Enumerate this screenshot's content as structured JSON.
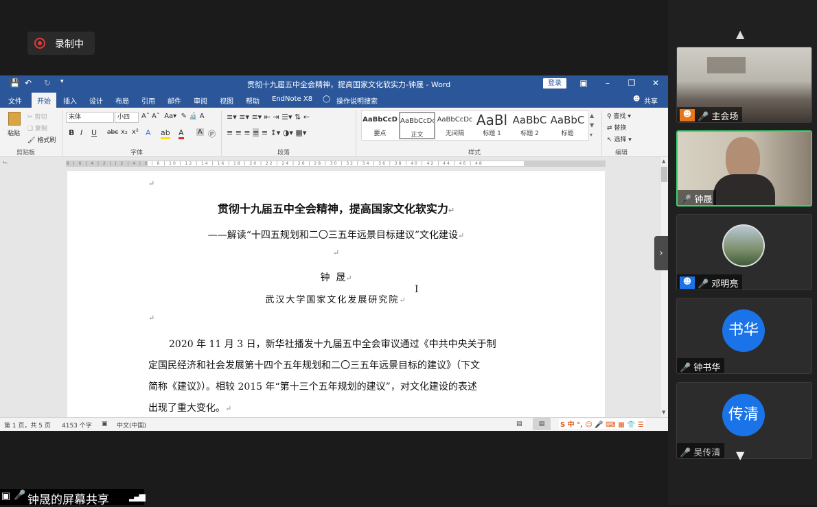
{
  "recording": {
    "label": "录制中"
  },
  "word": {
    "title": "贯彻十九届五中全会精神，提高国家文化软实力-钟晟 - Word",
    "login": "登录",
    "tabs": [
      "文件",
      "开始",
      "插入",
      "设计",
      "布局",
      "引用",
      "邮件",
      "审阅",
      "视图",
      "帮助",
      "EndNote X8"
    ],
    "tell_me": "操作说明搜索",
    "share": "共享",
    "clipboard": {
      "paste": "粘贴",
      "cut": "剪切",
      "copy": "复制",
      "format_painter": "格式刷",
      "group": "剪贴板"
    },
    "font": {
      "name": "宋体",
      "size": "小四",
      "group": "字体"
    },
    "paragraph_group": "段落",
    "styles": {
      "group": "样式",
      "items": [
        {
          "preview": "AaBbCcD",
          "name": "要点"
        },
        {
          "preview": "AaBbCcDc",
          "name": "正文"
        },
        {
          "preview": "AaBbCcDc",
          "name": "无间隔"
        },
        {
          "preview": "AaBl",
          "name": "标题 1"
        },
        {
          "preview": "AaBbC",
          "name": "标题 2"
        },
        {
          "preview": "AaBbC",
          "name": "标题"
        }
      ]
    },
    "editing": {
      "find": "查找",
      "replace": "替换",
      "select": "选择",
      "group": "编辑"
    },
    "ruler_text": "8 | 6 | 4 | 2 |   | 2 | 4 | 6 | 8 | 10 | 12 | 14 | 16 | 18 | 20 | 22 | 24 | 26 | 28 | 30 | 32 | 34 | 36 | 38 | 40 | 42 | 44 | 46 | 48",
    "document": {
      "title": "贯彻十九届五中全会精神，提高国家文化软实力",
      "subtitle": "——解读“十四五规划和二〇三五年远景目标建议”文化建设",
      "author": "钟  晟",
      "affiliation": "武汉大学国家文化发展研究院",
      "paragraph_lines": [
        "2020 年 11 月 3 日，新华社播发十九届五中全会审议通过《中共中央关于制",
        "定国民经济和社会发展第十四个五年规划和二〇三五年远景目标的建议》（下文",
        "简称《建议》）。相较 2015 年“第十三个五年规划的建议”，对文化建设的表述",
        "出现了重大变化。"
      ]
    },
    "status": {
      "page": "第 1 页，共 5 页",
      "words": "4153 个字",
      "language": "中文(中国)"
    }
  },
  "participants": [
    {
      "name": "主会场",
      "type": "video"
    },
    {
      "name": "钟晟",
      "type": "video",
      "speaking": true
    },
    {
      "name": "邓明亮",
      "type": "photo",
      "muted": true
    },
    {
      "name": "钟书华",
      "type": "avatar",
      "initials": "书华",
      "muted": true
    },
    {
      "name": "吴传清",
      "type": "avatar",
      "initials": "传清",
      "muted": true
    }
  ],
  "share_bar": {
    "label": "钟晟的屏幕共享"
  },
  "colors": {
    "word_blue": "#2b579a",
    "avatar_blue": "#1a73e8",
    "record_red": "#e03a3a",
    "speaking_green": "#3ad46a"
  }
}
